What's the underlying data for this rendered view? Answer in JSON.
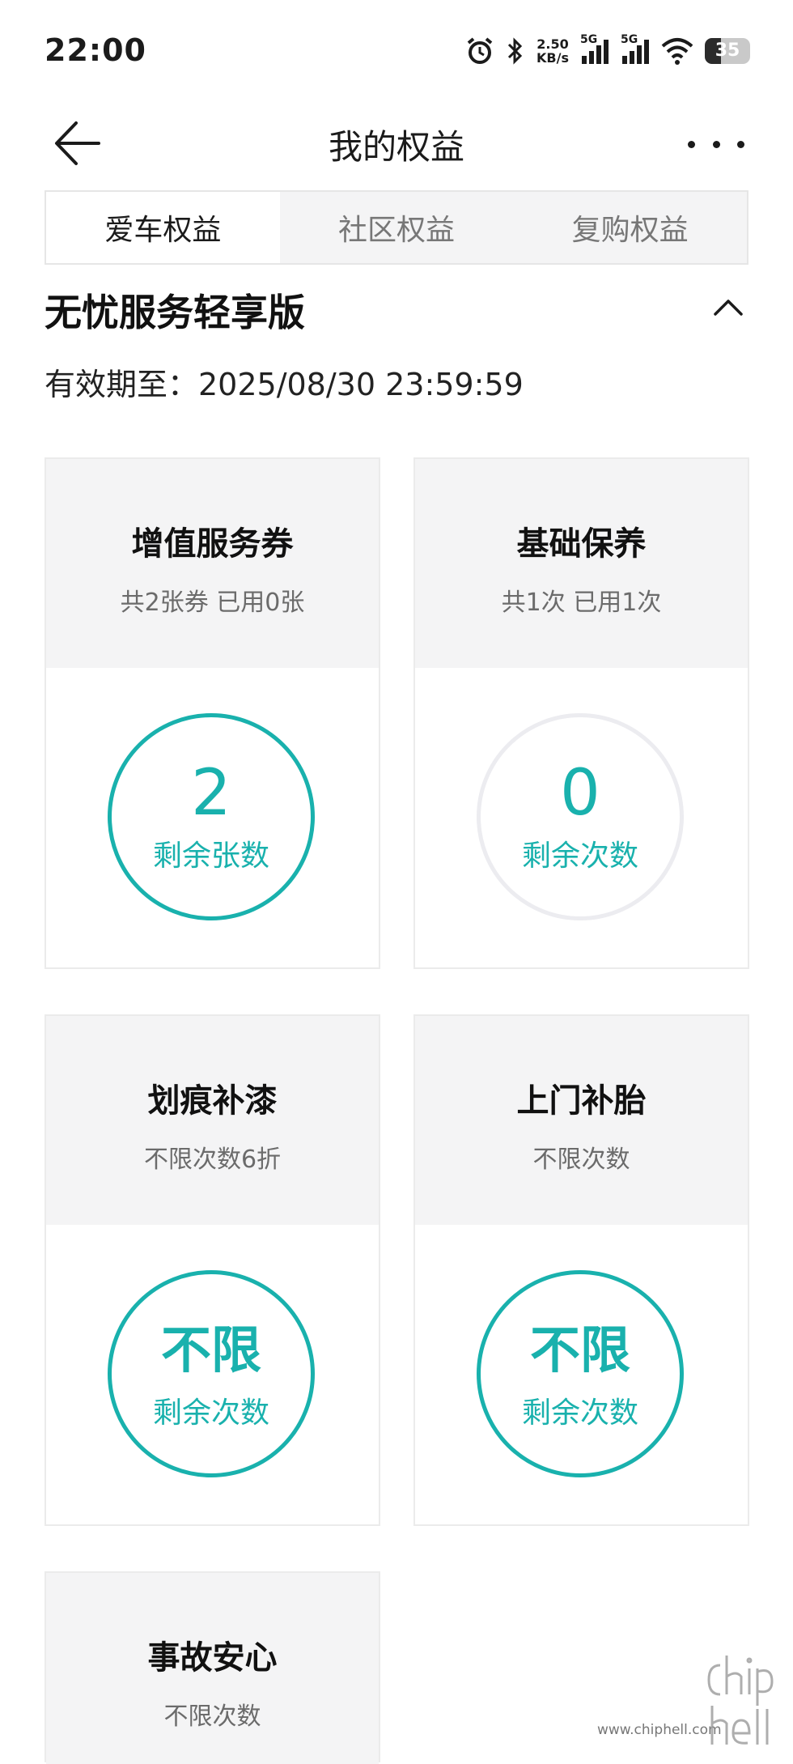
{
  "status_bar": {
    "time": "22:00",
    "net_speed_value": "2.50",
    "net_speed_unit": "KB/s",
    "signal1_label": "5G",
    "signal2_label": "5G",
    "battery": "35"
  },
  "nav": {
    "title": "我的权益"
  },
  "tabs": [
    {
      "label": "爱车权益",
      "active": true
    },
    {
      "label": "社区权益",
      "active": false
    },
    {
      "label": "复购权益",
      "active": false
    }
  ],
  "plan": {
    "name": "无忧服务轻享版",
    "validity": "有效期至：2025/08/30 23:59:59"
  },
  "cards": [
    {
      "title": "增值服务券",
      "subtitle": "共2张券 已用0张",
      "value": "2",
      "value_label": "剩余张数"
    },
    {
      "title": "基础保养",
      "subtitle": "共1次 已用1次",
      "value": "0",
      "value_label": "剩余次数"
    },
    {
      "title": "划痕补漆",
      "subtitle": "不限次数6折",
      "value": "不限",
      "value_label": "剩余次数"
    },
    {
      "title": "上门补胎",
      "subtitle": "不限次数",
      "value": "不限",
      "value_label": "剩余次数"
    },
    {
      "title": "事故安心",
      "subtitle": "不限次数"
    }
  ],
  "watermark": {
    "url": "www.chiphell.com"
  },
  "colors": {
    "accent": "#19b1ad",
    "card_header_bg": "#f4f4f5",
    "empty_ring": "#ececf0"
  }
}
